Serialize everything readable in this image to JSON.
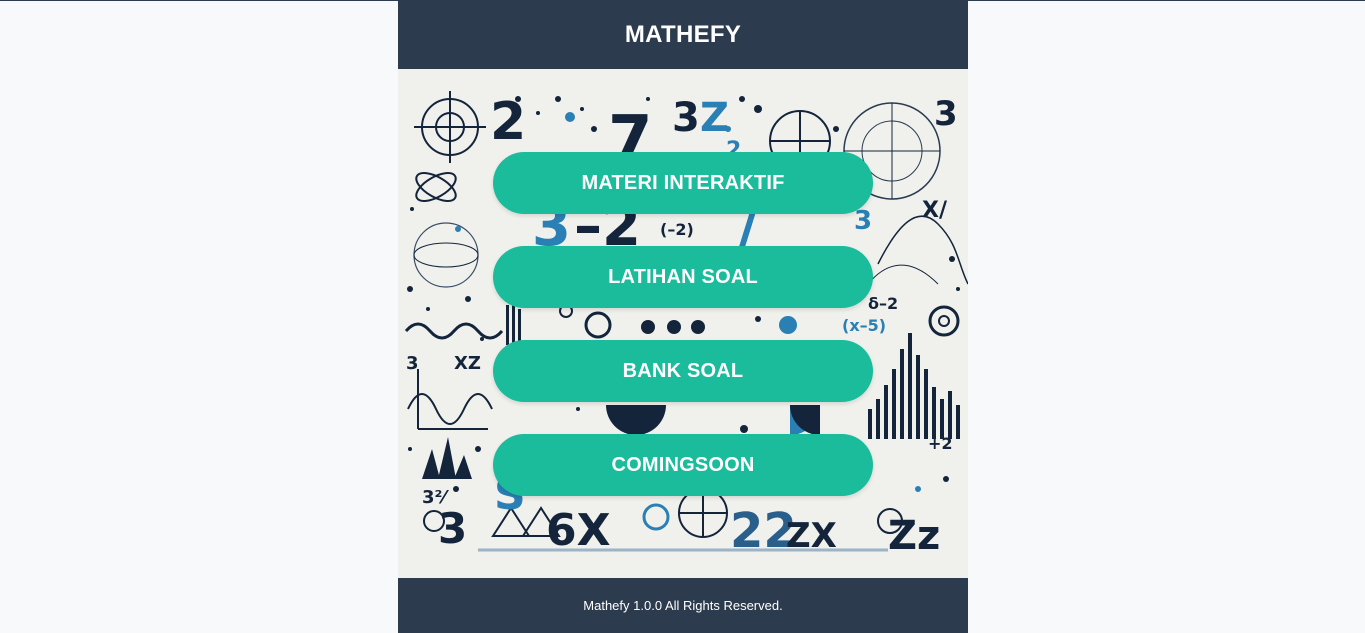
{
  "app": {
    "title": "MATHEFY"
  },
  "menu": {
    "items": [
      {
        "label": "MATERI INTERAKTIF"
      },
      {
        "label": "LATIHAN SOAL"
      },
      {
        "label": "BANK SOAL"
      },
      {
        "label": "COMINGSOON"
      }
    ]
  },
  "footer": {
    "text": "Mathefy 1.0.0 All Rights Reserved."
  },
  "colors": {
    "header_bg": "#2d3b4e",
    "button_bg": "#1abc9c",
    "page_bg": "#f7f9fb",
    "art_dark": "#13243b",
    "art_blue": "#2a7fb4"
  },
  "hero": {
    "image_name": "math-doodle-illustration"
  }
}
